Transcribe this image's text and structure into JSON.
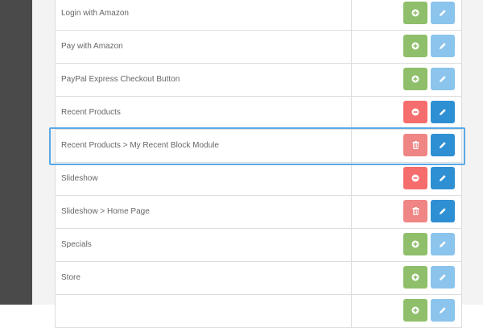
{
  "colors": {
    "install": "#8fbf6a",
    "uninstall": "#f56d6d",
    "uninstall_disabled": "#f08585",
    "edit_enabled": "#2f8fd3",
    "edit_disabled": "#8bc4ec",
    "highlight": "#5aa9e6"
  },
  "modules": [
    {
      "name": "Login with Amazon",
      "action": "install",
      "action_icon": "plus-circle-icon",
      "edit_state": "disabled"
    },
    {
      "name": "Pay with Amazon",
      "action": "install",
      "action_icon": "plus-circle-icon",
      "edit_state": "disabled"
    },
    {
      "name": "PayPal Express Checkout Button",
      "action": "install",
      "action_icon": "plus-circle-icon",
      "edit_state": "disabled"
    },
    {
      "name": "Recent Products",
      "action": "uninstall",
      "action_icon": "minus-circle-icon",
      "edit_state": "enabled"
    },
    {
      "name": "Recent Products > My Recent Block Module",
      "action": "delete",
      "action_icon": "trash-icon",
      "edit_state": "enabled",
      "highlighted": true
    },
    {
      "name": "Slideshow",
      "action": "uninstall",
      "action_icon": "minus-circle-icon",
      "edit_state": "enabled"
    },
    {
      "name": "Slideshow > Home Page",
      "action": "delete",
      "action_icon": "trash-icon",
      "edit_state": "enabled"
    },
    {
      "name": "Specials",
      "action": "install",
      "action_icon": "plus-circle-icon",
      "edit_state": "disabled"
    },
    {
      "name": "Store",
      "action": "install",
      "action_icon": "plus-circle-icon",
      "edit_state": "disabled"
    },
    {
      "name": "",
      "action": "install",
      "action_icon": "plus-circle-icon",
      "edit_state": "disabled"
    }
  ]
}
